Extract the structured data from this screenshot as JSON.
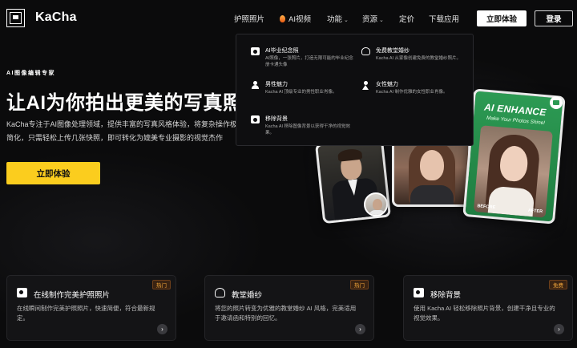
{
  "brand": {
    "name": "KaCha",
    "logo_text": "KA CHA"
  },
  "nav": {
    "passport": "护照照片",
    "ai_video": "AI视频",
    "features": "功能",
    "resources": "资源",
    "pricing": "定价",
    "download": "下载应用",
    "try_now": "立即体验",
    "login": "登录"
  },
  "hero": {
    "eyebrow": "AI图像编辑专家",
    "title": "让AI为你拍出更美的写真照",
    "description": "KaCha专注于AI图像处理领域，提供丰富的写真风格体验，将复杂操作极致简化，只需轻松上传几张快照，即可转化为媲美专业摄影的视觉杰作",
    "cta": "立即体验"
  },
  "dropdown": {
    "items": [
      {
        "title": "AI毕业纪念照",
        "desc": "AI照像，一张照片，打造无限可能的毕业纪念册卡通头像",
        "icon": "camera-icon"
      },
      {
        "title": "免费教堂婚纱",
        "desc": "Kacha AI 从家像创建免费的教堂婚纱照片。",
        "icon": "dress-icon"
      },
      {
        "title": "男性魅力",
        "desc": "Kacha AI 顶级专业的男性职业肖像。",
        "icon": "man-icon"
      },
      {
        "title": "女性魅力",
        "desc": "Kacha AI 制作优雅的女性职业肖像。",
        "icon": "woman-icon"
      },
      {
        "title": "移除背景",
        "desc": "Kacha AI 移除图像背景以获得干净的视觉效果。",
        "icon": "camera-icon"
      }
    ]
  },
  "showcase": {
    "enhance_title": "AI ENHANCE",
    "enhance_subtitle": "Make Your Photos Shine!",
    "before_label": "BEFORE",
    "after_label": "AFTER"
  },
  "features": [
    {
      "title": "在线制作完美护照照片",
      "badge": "热门",
      "desc": "在线瞬间制作完美护照照片，快速简便，符合最新规定。",
      "icon": "camera-icon"
    },
    {
      "title": "教堂婚纱",
      "badge": "热门",
      "desc": "将您的照片转变为优雅的教堂婚纱 AI 风格，完美适用于邀请函和特别的回忆。",
      "icon": "dress-icon"
    },
    {
      "title": "移除背景",
      "badge": "免费",
      "desc": "使用 Kacha AI 轻松移除照片背景，创建干净且专业的视觉效果。",
      "icon": "camera-icon"
    }
  ],
  "colors": {
    "background": "#0b0b0c",
    "accent_yellow": "#fbcd1e",
    "enhance_green": "#2c9a53",
    "badge_orange": "#f0a53a"
  }
}
